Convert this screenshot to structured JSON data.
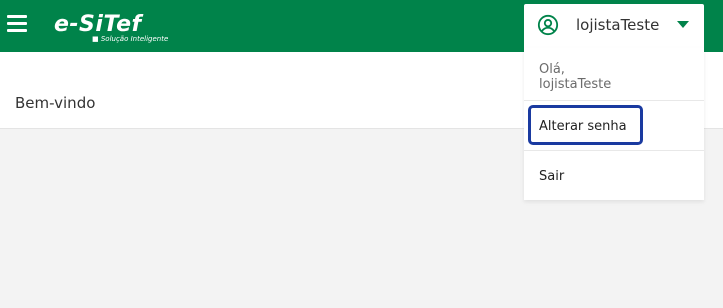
{
  "header": {
    "logo_text": "e-SiTef",
    "logo_tagline": "■ Solução Inteligente",
    "user_name": "lojistaTeste"
  },
  "page": {
    "title": "Bem-vindo"
  },
  "user_dropdown": {
    "greeting": "Olá, lojistaTeste",
    "items": [
      {
        "label": "Alterar senha"
      },
      {
        "label": "Sair"
      }
    ]
  },
  "colors": {
    "brand_green": "#00834a",
    "highlight_blue": "#1a3aa0"
  },
  "icons": {
    "menu": "hamburger-menu-icon",
    "user": "account-circle-icon",
    "caret": "caret-down-icon"
  }
}
